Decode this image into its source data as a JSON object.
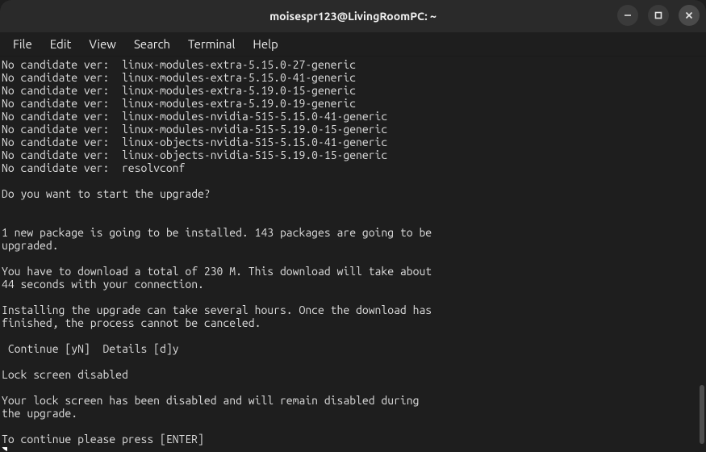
{
  "window": {
    "title": "moisespr123@LivingRoomPC: ~"
  },
  "menubar": {
    "items": [
      "File",
      "Edit",
      "View",
      "Search",
      "Terminal",
      "Help"
    ]
  },
  "terminal": {
    "lines": [
      "No candidate ver:  linux-modules-extra-5.15.0-27-generic",
      "No candidate ver:  linux-modules-extra-5.15.0-41-generic",
      "No candidate ver:  linux-modules-extra-5.19.0-15-generic",
      "No candidate ver:  linux-modules-extra-5.19.0-19-generic",
      "No candidate ver:  linux-modules-nvidia-515-5.15.0-41-generic",
      "No candidate ver:  linux-modules-nvidia-515-5.19.0-15-generic",
      "No candidate ver:  linux-objects-nvidia-515-5.15.0-41-generic",
      "No candidate ver:  linux-objects-nvidia-515-5.19.0-15-generic",
      "No candidate ver:  resolvconf",
      "",
      "Do you want to start the upgrade?",
      "",
      "",
      "1 new package is going to be installed. 143 packages are going to be",
      "upgraded.",
      "",
      "You have to download a total of 230 M. This download will take about",
      "44 seconds with your connection.",
      "",
      "Installing the upgrade can take several hours. Once the download has",
      "finished, the process cannot be canceled.",
      "",
      " Continue [yN]  Details [d]y",
      "",
      "Lock screen disabled",
      "",
      "Your lock screen has been disabled and will remain disabled during",
      "the upgrade.",
      "",
      "To continue please press [ENTER]"
    ]
  }
}
